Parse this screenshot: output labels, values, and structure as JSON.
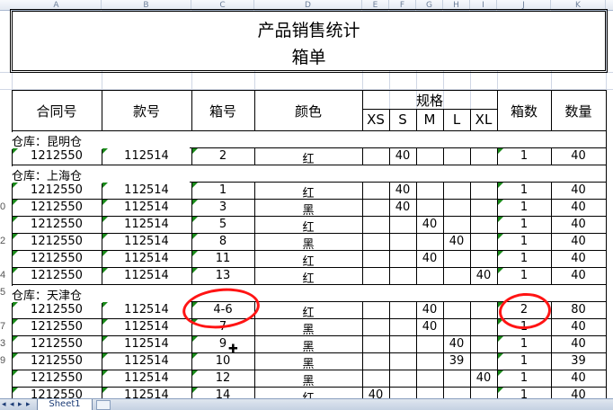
{
  "columns": [
    "A",
    "B",
    "C",
    "D",
    "E",
    "F",
    "G",
    "H",
    "I",
    "J",
    "K"
  ],
  "title": "产品销售统计",
  "subtitle": "箱单",
  "headers": {
    "contract": "合同号",
    "style": "款号",
    "box_no": "箱号",
    "color": "颜色",
    "spec": "规格",
    "sizes": [
      "XS",
      "S",
      "M",
      "L",
      "XL"
    ],
    "box_count": "箱数",
    "quantity": "数量"
  },
  "row_numbers": [
    "",
    "",
    "",
    "",
    "",
    "",
    "",
    "",
    "",
    "",
    "0",
    "",
    "2",
    "",
    "4",
    "5",
    "",
    "7",
    "3",
    "9",
    ""
  ],
  "rows": [
    {
      "type": "section",
      "label": "仓库：昆明仓"
    },
    {
      "type": "data",
      "contract": "1212550",
      "style": "112514",
      "box": "2",
      "color": "红",
      "xs": "",
      "s": "40",
      "m": "",
      "l": "",
      "xl": "",
      "boxes": "1",
      "qty": "40"
    },
    {
      "type": "section",
      "label": "仓库：上海仓"
    },
    {
      "type": "data",
      "contract": "1212550",
      "style": "112514",
      "box": "1",
      "color": "红",
      "xs": "",
      "s": "40",
      "m": "",
      "l": "",
      "xl": "",
      "boxes": "1",
      "qty": "40"
    },
    {
      "type": "data",
      "contract": "1212550",
      "style": "112514",
      "box": "3",
      "color": "黑",
      "xs": "",
      "s": "40",
      "m": "",
      "l": "",
      "xl": "",
      "boxes": "1",
      "qty": "40"
    },
    {
      "type": "data",
      "contract": "1212550",
      "style": "112514",
      "box": "5",
      "color": "红",
      "xs": "",
      "s": "",
      "m": "40",
      "l": "",
      "xl": "",
      "boxes": "1",
      "qty": "40"
    },
    {
      "type": "data",
      "contract": "1212550",
      "style": "112514",
      "box": "8",
      "color": "黑",
      "xs": "",
      "s": "",
      "m": "",
      "l": "40",
      "xl": "",
      "boxes": "1",
      "qty": "40"
    },
    {
      "type": "data",
      "contract": "1212550",
      "style": "112514",
      "box": "11",
      "color": "红",
      "xs": "",
      "s": "",
      "m": "40",
      "l": "",
      "xl": "",
      "boxes": "1",
      "qty": "40"
    },
    {
      "type": "data",
      "contract": "1212550",
      "style": "112514",
      "box": "13",
      "color": "红",
      "xs": "",
      "s": "",
      "m": "",
      "l": "",
      "xl": "40",
      "boxes": "1",
      "qty": "40"
    },
    {
      "type": "section",
      "label": "仓库：天津仓"
    },
    {
      "type": "data",
      "contract": "1212550",
      "style": "112514",
      "box": "4-6",
      "color": "红",
      "xs": "",
      "s": "",
      "m": "40",
      "l": "",
      "xl": "",
      "boxes": "2",
      "qty": "80"
    },
    {
      "type": "data",
      "contract": "1212550",
      "style": "112514",
      "box": "7",
      "color": "黑",
      "xs": "",
      "s": "",
      "m": "40",
      "l": "",
      "xl": "",
      "boxes": "1",
      "qty": "40"
    },
    {
      "type": "data",
      "contract": "1212550",
      "style": "112514",
      "box": "9",
      "color": "黑",
      "xs": "",
      "s": "",
      "m": "",
      "l": "40",
      "xl": "",
      "boxes": "1",
      "qty": "40"
    },
    {
      "type": "data",
      "contract": "1212550",
      "style": "112514",
      "box": "10",
      "color": "黑",
      "xs": "",
      "s": "",
      "m": "",
      "l": "39",
      "xl": "",
      "boxes": "1",
      "qty": "39"
    },
    {
      "type": "data",
      "contract": "1212550",
      "style": "112514",
      "box": "12",
      "color": "黑",
      "xs": "",
      "s": "",
      "m": "",
      "l": "",
      "xl": "40",
      "boxes": "1",
      "qty": "40"
    },
    {
      "type": "data",
      "contract": "1212550",
      "style": "112514",
      "box": "14",
      "color": "红",
      "xs": "40",
      "s": "",
      "m": "",
      "l": "",
      "xl": "",
      "boxes": "1",
      "qty": "40"
    }
  ],
  "sheet_tab": "Sheet1",
  "nav_icons": [
    "first-sheet-icon",
    "prev-sheet-icon",
    "next-sheet-icon",
    "last-sheet-icon"
  ],
  "colors": {
    "annotation": "#ff1414",
    "header_bg": "#e3e9f2",
    "error_flag": "#1a8a1a"
  }
}
